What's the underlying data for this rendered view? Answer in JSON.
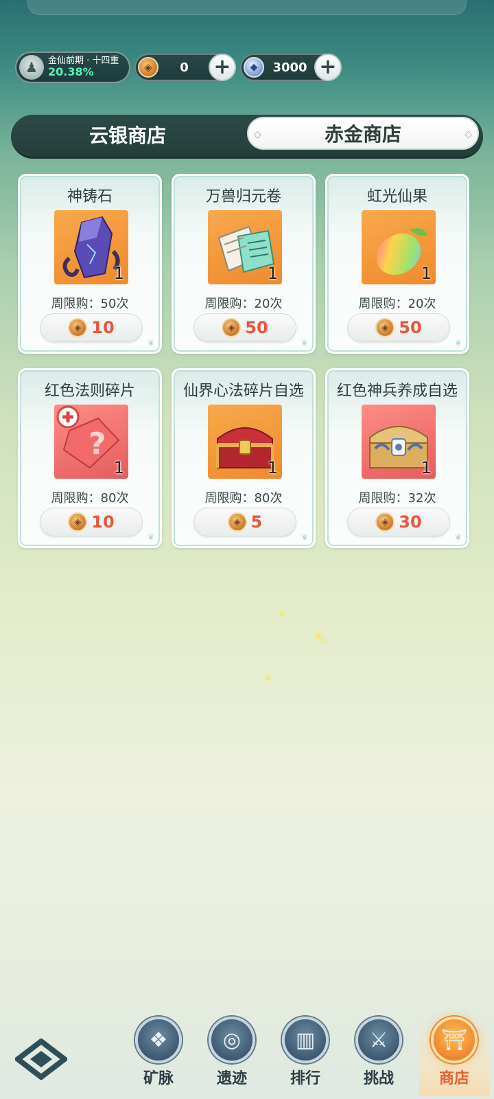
{
  "status": {
    "realm_name": "金仙前期 · 十四重",
    "realm_progress": "20.38%",
    "gold_amount": "0",
    "silver_amount": "3000"
  },
  "tabs": [
    {
      "label": "云银商店",
      "active": false
    },
    {
      "label": "赤金商店",
      "active": true
    }
  ],
  "items": [
    {
      "name": "神铸石",
      "qty": "1",
      "limit": "周限购：50次",
      "price": "10",
      "bg": "orange",
      "icon": "purple-crystal-icon"
    },
    {
      "name": "万兽归元卷",
      "qty": "1",
      "limit": "周限购：20次",
      "price": "50",
      "bg": "orange",
      "icon": "scroll-tickets-icon"
    },
    {
      "name": "虹光仙果",
      "qty": "1",
      "limit": "周限购：20次",
      "price": "50",
      "bg": "orange",
      "icon": "rainbow-mango-icon"
    },
    {
      "name": "红色法则碎片",
      "qty": "1",
      "limit": "周限购：80次",
      "price": "10",
      "bg": "red",
      "icon": "mystery-box-icon"
    },
    {
      "name": "仙界心法碎片自选",
      "qty": "1",
      "limit": "周限购：80次",
      "price": "5",
      "bg": "orange",
      "icon": "red-chest-icon"
    },
    {
      "name": "红色神兵养成自选",
      "qty": "1",
      "limit": "周限购：32次",
      "price": "30",
      "bg": "red",
      "icon": "gold-chest-icon"
    }
  ],
  "nav": [
    {
      "label": "矿脉",
      "icon": "crystal-icon",
      "active": false
    },
    {
      "label": "遗迹",
      "icon": "vortex-icon",
      "active": false
    },
    {
      "label": "排行",
      "icon": "podium-icon",
      "active": false
    },
    {
      "label": "挑战",
      "icon": "swords-icon",
      "active": false
    },
    {
      "label": "商店",
      "icon": "pagoda-icon",
      "active": true
    }
  ],
  "colors": {
    "price": "#e9563c",
    "active_nav": "#e8612e",
    "progress": "#5ef2b4"
  }
}
